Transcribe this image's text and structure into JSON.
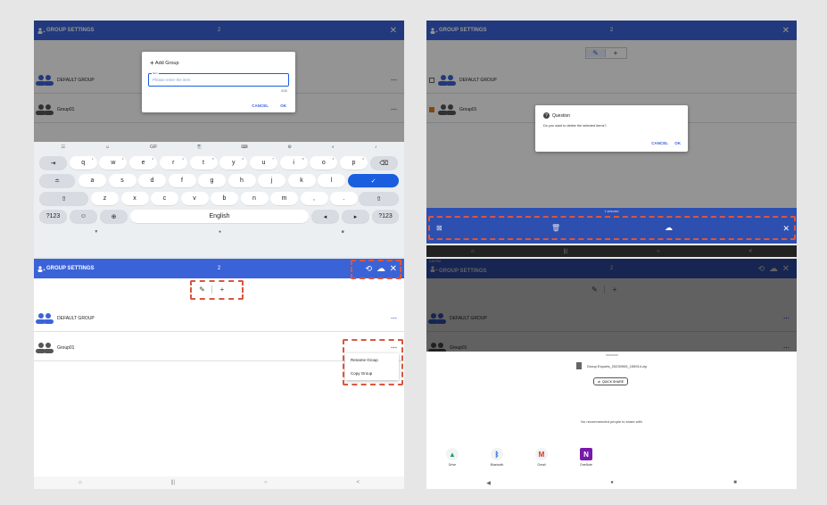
{
  "colors": {
    "header": "#3b63d8",
    "accent": "#1a5ddf",
    "highlight": "#d9573f",
    "text": "#222222"
  },
  "header": {
    "title": "GROUP SETTINGS",
    "count": "2",
    "close_icon": "close-icon"
  },
  "groups": [
    {
      "label": "DEFAULT GROUP",
      "more": "⋯"
    },
    {
      "label": "Group01",
      "more": "⋯"
    }
  ],
  "add_dialog": {
    "title": "Add Group",
    "field_label": "Item",
    "placeholder": "Please enter the item",
    "counter": "0/30",
    "cancel": "CANCEL",
    "ok": "OK"
  },
  "keyboard": {
    "toolbar": [
      "☷",
      "☺",
      "GIF",
      "⎘",
      "⌨",
      "⚙",
      "◐",
      "♪"
    ],
    "row1": [
      {
        "k": "⇥"
      },
      {
        "k": "q",
        "s": "1"
      },
      {
        "k": "w",
        "s": "2"
      },
      {
        "k": "e",
        "s": "3"
      },
      {
        "k": "r",
        "s": "4"
      },
      {
        "k": "t",
        "s": "5"
      },
      {
        "k": "y",
        "s": "6"
      },
      {
        "k": "u",
        "s": "7"
      },
      {
        "k": "i",
        "s": "8"
      },
      {
        "k": "o",
        "s": "9"
      },
      {
        "k": "p",
        "s": "0"
      },
      {
        "k": "⌫"
      }
    ],
    "row2": [
      "≐",
      "a",
      "s",
      "d",
      "f",
      "g",
      "h",
      "j",
      "k",
      "l",
      "✓"
    ],
    "row3": [
      "⇧",
      "z",
      "x",
      "c",
      "v",
      "b",
      "n",
      "m",
      ",",
      ".",
      "⇧"
    ],
    "row4": [
      "?123",
      "☺",
      "⊕",
      "English",
      "◂",
      "▸",
      "?123"
    ],
    "nav": [
      "▼",
      "●",
      "■"
    ]
  },
  "delete_dialog": {
    "title": "Question",
    "message": "Do you want to delete the selected items?",
    "cancel": "CANCEL",
    "ok": "OK",
    "selected_label": "1 selected"
  },
  "context_menu": {
    "items": [
      "Rename Group",
      "Copy Group"
    ]
  },
  "share_sheet": {
    "status_time": "2:59 PM",
    "file_name": "Group Exports_20230905_155914.zip",
    "quick_share": "QUICK SHARE",
    "no_recommend": "No recommended people to share with",
    "apps": [
      {
        "name": "Drive",
        "icon": "▲"
      },
      {
        "name": "Bluetooth",
        "icon": "ᛒ"
      },
      {
        "name": "Gmail",
        "icon": "M"
      },
      {
        "name": "OneNote",
        "icon": "N"
      }
    ],
    "nav": [
      "◀",
      "●",
      "■"
    ]
  },
  "sys_nav": [
    "⌂",
    "|||",
    "○",
    "<"
  ]
}
